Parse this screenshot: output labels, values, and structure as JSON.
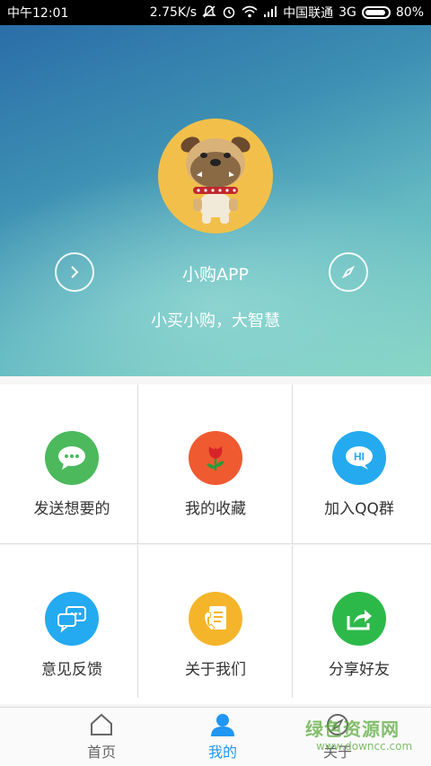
{
  "status_bar": {
    "time": "中午12:01",
    "speed": "2.75K/s",
    "carrier": "中国联通",
    "network": "3G",
    "battery": "80%"
  },
  "hero": {
    "app_name": "小购APP",
    "tagline": "小买小购，大智慧"
  },
  "grid": {
    "items": [
      {
        "label": "发送想要的",
        "icon": "chat-bubble-icon",
        "color": "#4cb95c"
      },
      {
        "label": "我的收藏",
        "icon": "tulip-icon",
        "color": "#f05a31"
      },
      {
        "label": "加入QQ群",
        "icon": "hi-bubble-icon",
        "color": "#25aaf0"
      },
      {
        "label": "意见反馈",
        "icon": "feedback-chat-icon",
        "color": "#24aaf0"
      },
      {
        "label": "关于我们",
        "icon": "phone-document-icon",
        "color": "#f5b52a"
      },
      {
        "label": "分享好友",
        "icon": "share-arrow-icon",
        "color": "#2db94a"
      }
    ]
  },
  "bottom_nav": {
    "items": [
      {
        "label": "首页",
        "icon": "home-icon",
        "active": false
      },
      {
        "label": "我的",
        "icon": "user-icon",
        "active": true
      },
      {
        "label": "关于",
        "icon": "compass-icon",
        "active": false
      }
    ],
    "active_color": "#2196f3",
    "inactive_color": "#666666"
  },
  "watermark": {
    "text": "绿色资源网",
    "sub": "www.downcc.com"
  }
}
